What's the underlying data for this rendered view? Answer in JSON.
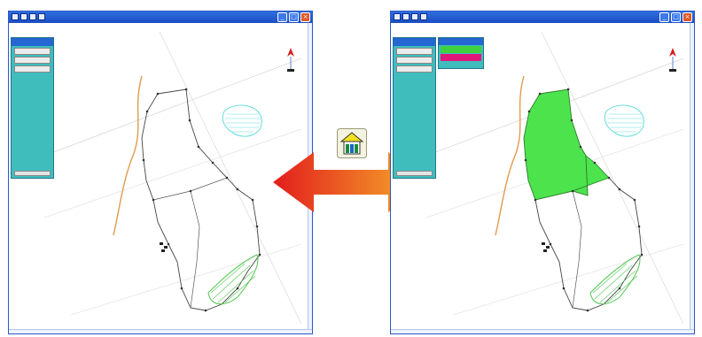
{
  "colors": {
    "titlebar": "#2f6fe0",
    "panel": "#3fbdbd",
    "parcel_fill": "#4de34d",
    "pond": "#66dddd",
    "forest": "#52c552",
    "road": "#e39a50",
    "arrow_start": "#e21d1d",
    "arrow_end": "#f7b02a"
  },
  "icons": {
    "center": "house-icon",
    "arrow": "double-headed-arrow",
    "north": "north-arrow-icon"
  },
  "left_window": {
    "panel_buttons": [
      "",
      "",
      ""
    ]
  },
  "right_window": {
    "panel_buttons": [
      "",
      "",
      ""
    ],
    "popup_items": [
      "",
      ""
    ]
  }
}
